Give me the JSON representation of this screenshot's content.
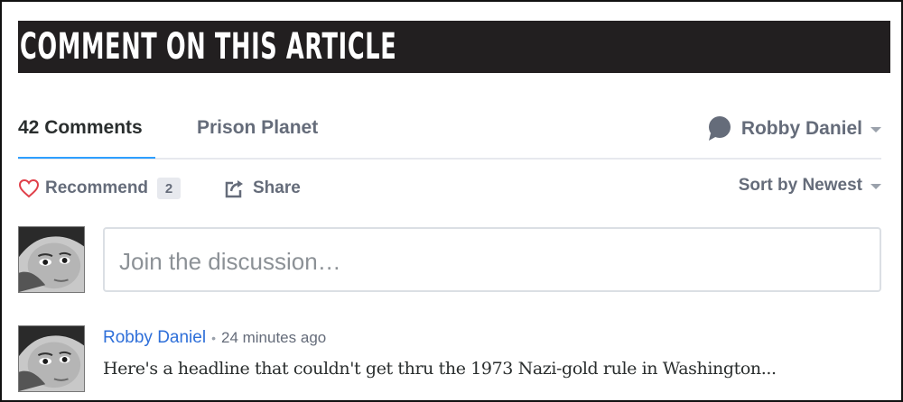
{
  "banner": {
    "title": "COMMENT ON THIS ARTICLE"
  },
  "tabs": {
    "comments_label": "42 Comments",
    "forum_label": "Prison Planet"
  },
  "user_menu": {
    "name": "Robby Daniel",
    "icon": "chat-bubble-icon"
  },
  "actions": {
    "recommend_label": "Recommend",
    "recommend_count": "2",
    "share_label": "Share",
    "sort_label": "Sort by Newest"
  },
  "composer": {
    "placeholder": "Join the discussion…"
  },
  "comments": [
    {
      "author": "Robby Daniel",
      "separator": "•",
      "time": "24 minutes ago",
      "body": "Here's a headline that couldn't get thru the 1973 Nazi-gold rule in Washington..."
    }
  ],
  "colors": {
    "banner_bg": "#221f20",
    "active_tab_underline": "#2e9fff",
    "author_link": "#2e6fd9",
    "heart": "#e0404a",
    "muted_text": "#656c7a"
  }
}
